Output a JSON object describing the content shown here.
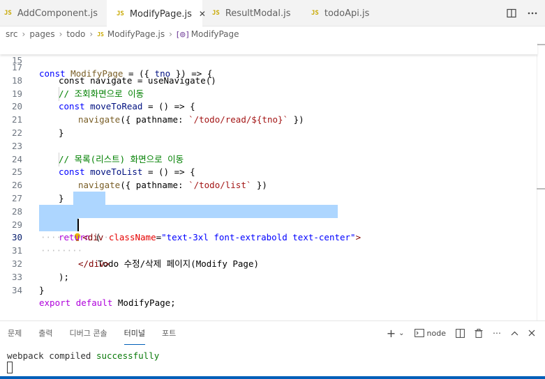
{
  "tabs": [
    {
      "badge": "JS",
      "label": "AddComponent.js",
      "active": false
    },
    {
      "badge": "JS",
      "label": "ModifyPage.js",
      "active": true,
      "close": "✕"
    },
    {
      "badge": "JS",
      "label": "ResultModal.js",
      "active": false
    },
    {
      "badge": "JS",
      "label": "todoApi.js",
      "active": false
    }
  ],
  "tab_actions": {
    "split_icon": "split-editor-icon",
    "more_icon": "more-actions-icon"
  },
  "breadcrumb": {
    "items": [
      "src",
      "pages",
      "todo"
    ],
    "file_badge": "JS",
    "file": "ModifyPage.js",
    "symbol_icon": "[⊚]",
    "symbol": "ModifyPage"
  },
  "editor": {
    "sticky": {
      "num": "15",
      "tokens": [
        "const",
        " ",
        "ModifyPage",
        " = ({ ",
        "tno",
        " }) => {"
      ]
    },
    "peek": "const navigate = useNavigate()",
    "lines": {
      "l17": "17",
      "l18": "18",
      "c18": "// 조회화면으로 이동",
      "l19": "19",
      "l20": "20",
      "l21": "21",
      "l22": "22",
      "l23": "23",
      "c23": "// 목록(리스트) 화면으로 이동",
      "l24": "24",
      "l25": "25",
      "l26": "26",
      "l27": "27",
      "l28": "28",
      "l29": "29",
      "l30": "30",
      "l31": "31",
      "l32": "32",
      "l33": "33",
      "l34": "34"
    },
    "t": {
      "const": "const",
      "moveToRead": "moveToRead",
      "moveToList": "moveToList",
      "arrow": " = () => {",
      "navigate": "navigate",
      "pathname": "({ pathname: ",
      "read_path": "`/todo/read/${tno}`",
      "list_path": "`/todo/list`",
      "close_call": " })",
      "brace": "}",
      "return": "return",
      "paren": " (",
      "div_open": "<div",
      "className": "className",
      "eq": "=",
      "class_val": "\"text-3xl font-extrabold text-center\"",
      "gt": ">",
      "body_text": "Todo 수정/삭제 페이지(Modify Page)",
      "div_close": "</div>",
      "close_paren": ");",
      "close_brace": "}",
      "export": "export",
      "default": "default",
      "export_name": " ModifyPage;",
      "dots6": "······",
      "dots8": "········"
    }
  },
  "panel": {
    "tabs": [
      "문제",
      "출력",
      "디버그 콘솔",
      "터미널",
      "포트"
    ],
    "active_tab": 3,
    "actions": {
      "add": "+",
      "dropdown": "⌄",
      "terminal_icon": "terminal-icon",
      "terminal_name": "node",
      "split": "split-terminal-icon",
      "trash": "trash-icon",
      "more": "⋯",
      "maximize": "chevron-up-icon",
      "close": "close-icon"
    },
    "terminal": {
      "prefix": "webpack compiled ",
      "status": "successfully"
    }
  },
  "colors": {
    "accent": "#005fb8",
    "selection": "#add6ff",
    "js_badge": "#c8a800"
  }
}
